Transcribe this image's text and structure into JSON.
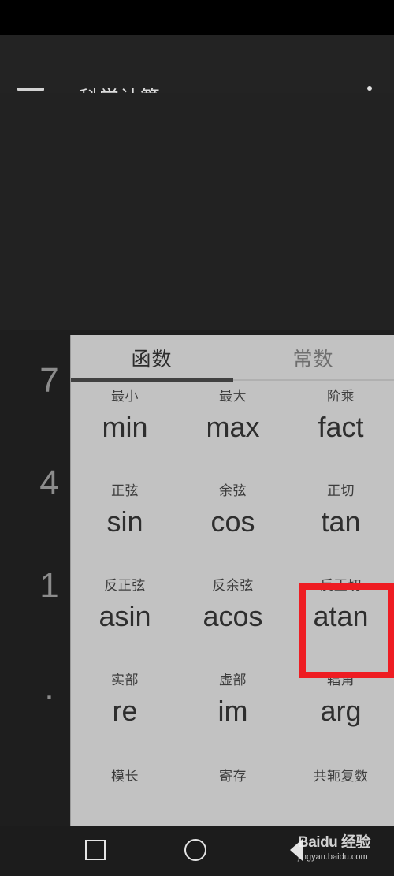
{
  "app": {
    "title": "科学计算",
    "menu_icon": "hamburger-icon",
    "overflow_icon": "more-vertical-icon"
  },
  "display": {
    "expression": ""
  },
  "keypad": {
    "rows": [
      [
        "7",
        "",
        "",
        ""
      ],
      [
        "4",
        "",
        "",
        ""
      ],
      [
        "1",
        "",
        "",
        ""
      ],
      [
        ".",
        "",
        "",
        ""
      ]
    ]
  },
  "panel": {
    "tabs": [
      {
        "label": "函数",
        "active": true
      },
      {
        "label": "常数",
        "active": false
      }
    ],
    "rows": [
      [
        {
          "label": "最小",
          "name": "min"
        },
        {
          "label": "最大",
          "name": "max"
        },
        {
          "label": "阶乘",
          "name": "fact"
        }
      ],
      [
        {
          "label": "正弦",
          "name": "sin"
        },
        {
          "label": "余弦",
          "name": "cos"
        },
        {
          "label": "正切",
          "name": "tan"
        }
      ],
      [
        {
          "label": "反正弦",
          "name": "asin"
        },
        {
          "label": "反余弦",
          "name": "acos"
        },
        {
          "label": "反正切",
          "name": "atan"
        }
      ],
      [
        {
          "label": "实部",
          "name": "re"
        },
        {
          "label": "虚部",
          "name": "im"
        },
        {
          "label": "辐角",
          "name": "arg"
        }
      ],
      [
        {
          "label": "模长",
          "name": ""
        },
        {
          "label": "寄存",
          "name": ""
        },
        {
          "label": "共轭复数",
          "name": ""
        }
      ]
    ]
  },
  "annotation": {
    "target": "atan",
    "color": "#ee1c22"
  },
  "navbar": {
    "recents": "square-icon",
    "home": "circle-icon",
    "back": "triangle-back-icon"
  },
  "watermark": {
    "main": "Baidu 经验",
    "url": "jingyan.baidu.com"
  }
}
